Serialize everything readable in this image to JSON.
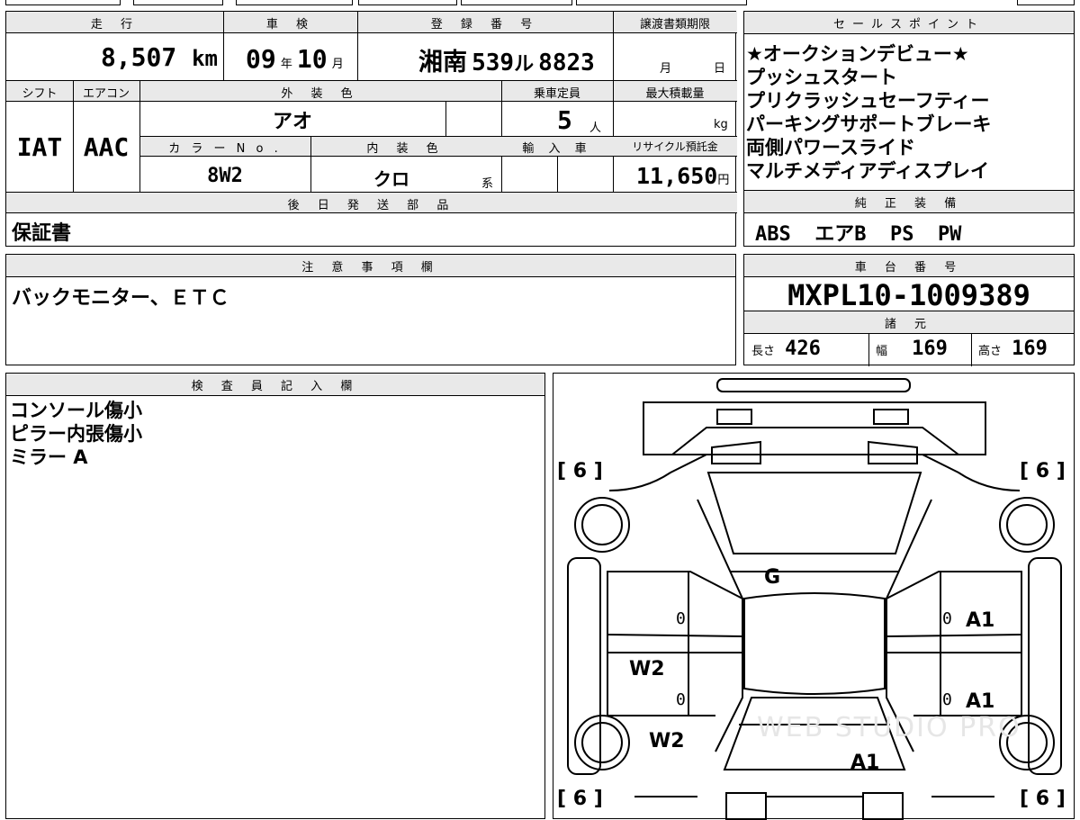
{
  "top_strip": {},
  "summary": {
    "mileage_label": "走 行",
    "mileage_value": "8,507",
    "mileage_unit": "km",
    "inspection_label": "車 検",
    "inspection_year": "09",
    "inspection_year_unit": "年",
    "inspection_month": "10",
    "inspection_month_unit": "月",
    "registration_label": "登 録 番 号",
    "registration_area": "湘南",
    "registration_class": "539",
    "registration_kana": "ル",
    "registration_number": "8823",
    "transfer_label": "譲渡書類期限",
    "transfer_month_unit": "月",
    "transfer_day_unit": "日",
    "shift_label": "シフト",
    "shift_value": "IAT",
    "ac_label": "エアコン",
    "ac_value": "AAC",
    "exterior_label": "外 装 色",
    "exterior_value": "アオ",
    "capacity_label": "乗車定員",
    "capacity_value": "5",
    "capacity_unit": "人",
    "max_load_label": "最大積載量",
    "max_load_unit": "kg",
    "color_no_label": "カ ラ ー N o .",
    "color_no_value": "8W2",
    "interior_label": "内 装 色",
    "interior_value": "クロ",
    "interior_unit": "系",
    "import_label": "輸 入 車",
    "recycle_label": "リサイクル預託金",
    "recycle_value": "11,650",
    "recycle_unit": "円",
    "later_parts_label": "後 日 発 送 部 品",
    "later_parts_value": "保証書"
  },
  "sales_points": {
    "label": "セールスポイント",
    "items": [
      "★オークションデビュー★",
      "プッシュスタート",
      "プリクラッシュセーフティー",
      "パーキングサポートブレーキ",
      "両側パワースライド",
      "マルチメディアディスプレイ"
    ]
  },
  "genuine_equipment": {
    "label": "純 正 装 備",
    "value": "ABS  エアB  PS  PW"
  },
  "notes": {
    "label": "注 意 事 項 欄",
    "value": "バックモニター、ＥＴＣ"
  },
  "chassis": {
    "label": "車 台 番 号",
    "value": "MXPL10-1009389",
    "spec_label": "諸 元",
    "length_label": "長さ",
    "length_value": "426",
    "width_label": "幅",
    "width_value": "169",
    "height_label": "高さ",
    "height_value": "169"
  },
  "inspector": {
    "label": "検 査 員 記 入 欄",
    "lines": [
      "コンソール傷小",
      "ピラー内張傷小",
      "ミラー A"
    ]
  },
  "diagram": {
    "tire_fl": "6",
    "tire_fr": "6",
    "tire_rl": "6",
    "tire_rr": "6",
    "marks": {
      "windshield": "G",
      "left_front_door": "0",
      "right_front_door": "0",
      "right_front_door_code": "A1",
      "left_rear_door_code": "W2",
      "left_rear_door": "0",
      "right_rear_door": "0",
      "right_rear_door_code": "A1",
      "left_rear_quarter": "W2",
      "rear_right": "A1"
    },
    "watermark": "WEB STUDIO PRO"
  },
  "colors": {
    "header_bg": "#e9e9e9",
    "line": "#000000"
  }
}
